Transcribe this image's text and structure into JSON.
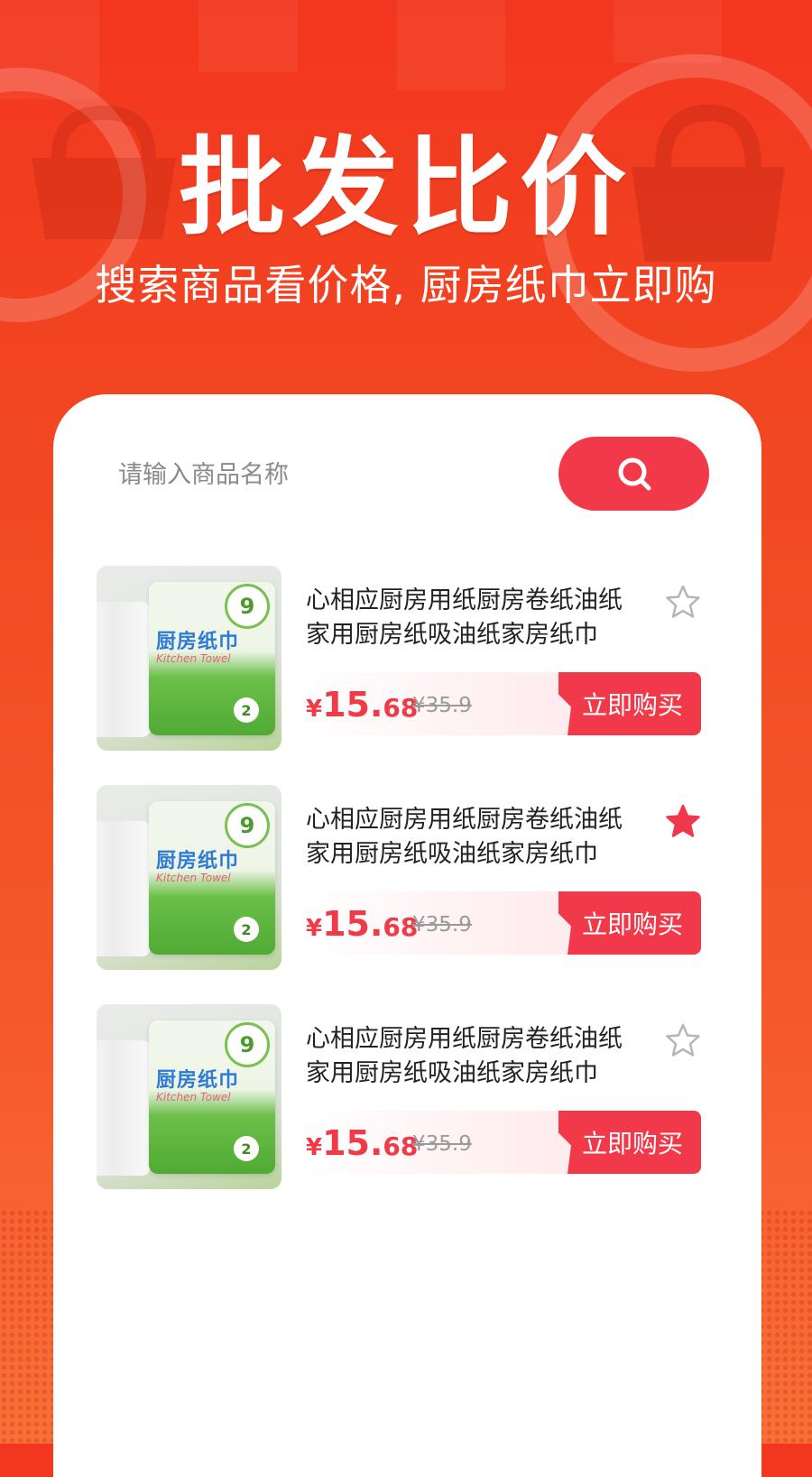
{
  "hero": {
    "title": "批发比价",
    "subtitle": "搜索商品看价格, 厨房纸巾立即购"
  },
  "search": {
    "placeholder": "请输入商品名称",
    "value": "",
    "button_icon": "search-icon",
    "button_color": "#f2394a"
  },
  "products": [
    {
      "title": "心相应厨房用纸厨房卷纸油纸家用厨房纸吸油纸家房纸巾",
      "image_badge": "9",
      "image_title": "厨房纸巾",
      "image_sub": "Kitchen Towel",
      "image_count": "2",
      "currency": "¥",
      "price_int": "15.",
      "price_dec": "68",
      "old_price": "¥35.9",
      "buy_label": "立即购买",
      "favorited": false,
      "fav_icon": "star-outline-icon"
    },
    {
      "title": "心相应厨房用纸厨房卷纸油纸家用厨房纸吸油纸家房纸巾",
      "image_badge": "9",
      "image_title": "厨房纸巾",
      "image_sub": "Kitchen Towel",
      "image_count": "2",
      "currency": "¥",
      "price_int": "15.",
      "price_dec": "68",
      "old_price": "¥35.9",
      "buy_label": "立即购买",
      "favorited": true,
      "fav_icon": "star-filled-icon"
    },
    {
      "title": "心相应厨房用纸厨房卷纸油纸家用厨房纸吸油纸家房纸巾",
      "image_badge": "9",
      "image_title": "厨房纸巾",
      "image_sub": "Kitchen Towel",
      "image_count": "2",
      "currency": "¥",
      "price_int": "15.",
      "price_dec": "68",
      "old_price": "¥35.9",
      "buy_label": "立即购买",
      "favorited": false,
      "fav_icon": "star-outline-icon"
    }
  ],
  "colors": {
    "accent": "#f2394a",
    "background_top": "#f3361f",
    "background_bottom": "#fb6f37",
    "star_filled": "#f0384a",
    "star_outline": "#b5b5b5"
  }
}
